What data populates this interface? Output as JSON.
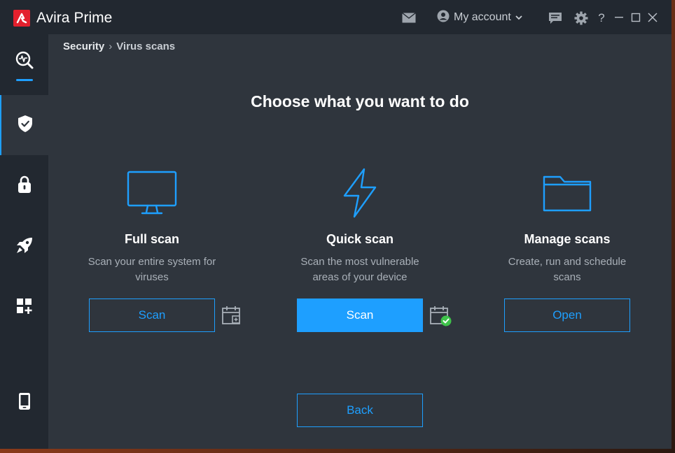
{
  "titlebar": {
    "brand": "Avira",
    "product": "Prime",
    "account_label": "My account",
    "help_label": "?"
  },
  "breadcrumb": {
    "parent": "Security",
    "separator": "›",
    "current": "Virus scans"
  },
  "main": {
    "heading": "Choose what you want to do",
    "cards": [
      {
        "title": "Full scan",
        "desc_line1": "Scan your entire system for",
        "desc_line2": "viruses",
        "button": "Scan"
      },
      {
        "title": "Quick scan",
        "desc_line1": "Scan the most vulnerable",
        "desc_line2": "areas of your device",
        "button": "Scan"
      },
      {
        "title": "Manage scans",
        "desc_line1": "Create, run and schedule",
        "desc_line2": "scans",
        "button": "Open"
      }
    ],
    "back_button": "Back"
  },
  "sidebar": {
    "items": [
      {
        "icon": "status-search-icon"
      },
      {
        "icon": "shield-check-icon",
        "active": true
      },
      {
        "icon": "lock-icon"
      },
      {
        "icon": "rocket-icon"
      },
      {
        "icon": "add-apps-icon"
      },
      {
        "icon": "mobile-device-icon"
      }
    ]
  },
  "colors": {
    "accent": "#1e9fff",
    "brand_red": "#e3202d",
    "background": "#2f353d",
    "sidebar": "#222830"
  }
}
